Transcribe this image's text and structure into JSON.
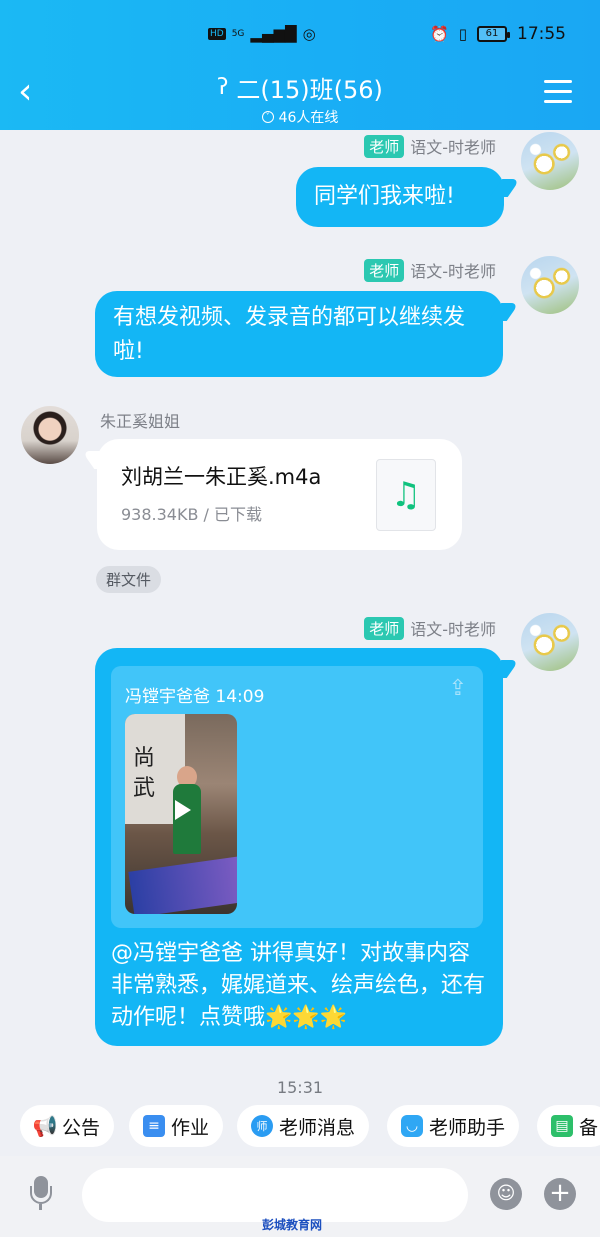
{
  "status_bar": {
    "left_icons": [
      "HD",
      "5G",
      "signal",
      "hotspot"
    ],
    "time": "17:55",
    "battery": "61"
  },
  "header": {
    "title": "二(15)班(56)",
    "online": "46人在线"
  },
  "messages": [
    {
      "role_badge": "老师",
      "sender": "语文-时老师",
      "text": "同学们我来啦!"
    },
    {
      "role_badge": "老师",
      "sender": "语文-时老师",
      "text": "有想发视频、发录音的都可以继续发啦!"
    },
    {
      "sender": "朱正奚姐姐",
      "file_name": "刘胡兰一朱正奚.m4a",
      "file_meta": "938.34KB / 已下载",
      "file_icon": "music-note"
    },
    {
      "tag": "群文件"
    },
    {
      "role_badge": "老师",
      "sender": "语文-时老师",
      "share_head": "冯镗宇爸爸 14:09",
      "video_calligraphy": "尚武",
      "text": "@冯镗宇爸爸 讲得真好！对故事内容非常熟悉，娓娓道来、绘声绘色，还有动作呢！点赞哦🌟🌟🌟"
    }
  ],
  "timestamp": "15:31",
  "quick_actions": [
    {
      "label": "公告",
      "icon": "megaphone-icon",
      "color": "#1aa0f0"
    },
    {
      "label": "作业",
      "icon": "document-icon",
      "color": "#3a8ef0"
    },
    {
      "label": "老师消息",
      "icon": "teacher-icon",
      "color": "#2a9cf2"
    },
    {
      "label": "老师助手",
      "icon": "assistant-icon",
      "color": "#2fa7f4"
    },
    {
      "label": "备",
      "icon": "prepare-icon",
      "color": "#2dbf6a"
    }
  ],
  "input": {
    "placeholder": ""
  },
  "watermark": "彭城教育网"
}
